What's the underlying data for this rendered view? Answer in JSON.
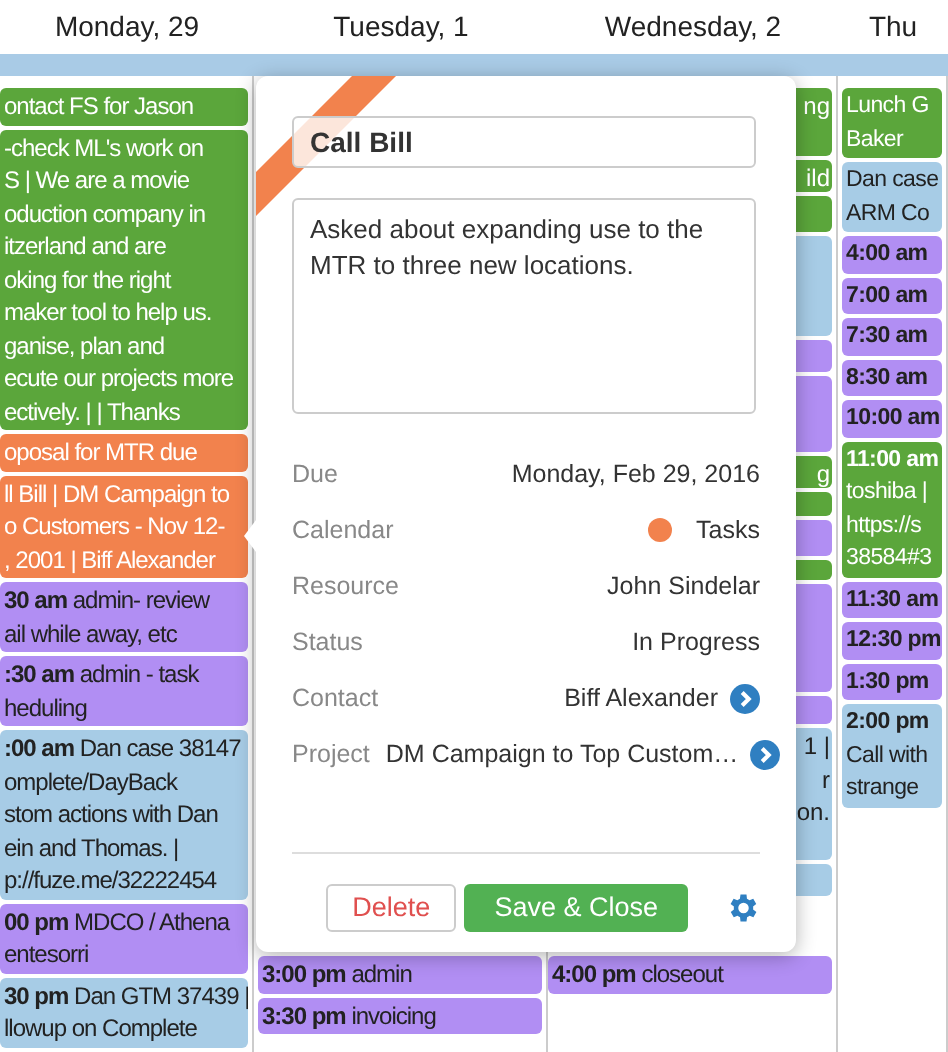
{
  "days": [
    {
      "label": "Monday, 29"
    },
    {
      "label": "Tuesday, 1"
    },
    {
      "label": "Wednesday, 2"
    },
    {
      "label": "Thu"
    }
  ],
  "columns": [
    {
      "events": [
        {
          "color": "#5ba63b",
          "lines": [
            "ontact FS for Jason"
          ]
        },
        {
          "color": "#5ba63b",
          "lines": [
            "-check ML's work on",
            "S | We are a movie",
            "oduction company in",
            "itzerland and are",
            "oking for the right",
            "maker tool to help us.",
            "ganise, plan and",
            "ecute our projects more",
            "ectively. | | Thanks"
          ]
        },
        {
          "color": "#f2824d",
          "lines": [
            "oposal for MTR due"
          ]
        },
        {
          "color": "#f2824d",
          "lines": [
            "ll Bill | DM Campaign to",
            "o Customers - Nov 12-",
            ", 2001 | Biff Alexander"
          ]
        },
        {
          "color": "#b18ef3",
          "time": "30 am",
          "lines": [
            "admin- review",
            "ail while away, etc"
          ]
        },
        {
          "color": "#b18ef3",
          "time": ":30 am",
          "lines": [
            "admin - task",
            "heduling"
          ]
        },
        {
          "color": "#a7cce6",
          "time": ":00 am",
          "lines": [
            "Dan case 38147",
            "omplete/DayBack",
            "stom actions with Dan",
            "ein and Thomas. |",
            "p://fuze.me/32222454"
          ]
        },
        {
          "color": "#b18ef3",
          "time": "00 pm",
          "lines": [
            "MDCO / Athena",
            "entesorri"
          ]
        },
        {
          "color": "#a7cce6",
          "time": "30 pm",
          "lines": [
            "Dan GTM 37439 |",
            "llowup on Complete"
          ]
        }
      ]
    },
    {
      "events": [
        {
          "color": "#b18ef3",
          "time": "3:00 pm",
          "lines": [
            "admin"
          ]
        },
        {
          "color": "#b18ef3",
          "time": "3:30 pm",
          "lines": [
            "invoicing"
          ]
        }
      ]
    },
    {
      "events": [
        {
          "color": "#5ba63b",
          "lines": [
            "ng"
          ]
        },
        {
          "color": "#5ba63b",
          "lines": [
            "ild"
          ]
        },
        {
          "color": "#5ba63b"
        },
        {
          "color": "#a7cce6"
        },
        {
          "color": "#b18ef3"
        },
        {
          "color": "#b18ef3"
        },
        {
          "color": "#5ba63b",
          "lines": [
            "g"
          ]
        },
        {
          "color": "#5ba63b"
        },
        {
          "color": "#b18ef3"
        },
        {
          "color": "#5ba63b"
        },
        {
          "color": "#b18ef3"
        },
        {
          "color": "#b18ef3"
        },
        {
          "color": "#a7cce6",
          "lines": [
            "1 |",
            "r",
            "on."
          ]
        },
        {
          "color": "#a7cce6"
        },
        {
          "color": "#b18ef3",
          "time": "4:00 pm",
          "lines": [
            "closeout"
          ]
        }
      ]
    },
    {
      "events": [
        {
          "color": "#5ba63b",
          "lines": [
            "Lunch G",
            "Baker"
          ]
        },
        {
          "color": "#a7cce6",
          "lines": [
            "Dan case",
            "ARM Co"
          ]
        },
        {
          "color": "#b18ef3",
          "time": "4:00 am"
        },
        {
          "color": "#b18ef3",
          "time": "7:00 am"
        },
        {
          "color": "#b18ef3",
          "time": "7:30 am"
        },
        {
          "color": "#b18ef3",
          "time": "8:30 am"
        },
        {
          "color": "#b18ef3",
          "time": "10:00 am"
        },
        {
          "color": "#5ba63b",
          "time": "11:00 am",
          "lines": [
            "toshiba |",
            "https://s",
            "38584#3"
          ]
        },
        {
          "color": "#b18ef3",
          "time": "11:30 am"
        },
        {
          "color": "#b18ef3",
          "time": "12:30 pm"
        },
        {
          "color": "#b18ef3",
          "time": "1:30 pm"
        },
        {
          "color": "#a7cce6",
          "time": "2:00 pm",
          "lines": [
            "Call with",
            "strange"
          ]
        }
      ]
    }
  ],
  "popover": {
    "title_field": {
      "value": "Call Bill"
    },
    "notes_field": {
      "value": "Asked about expanding use to the MTR to three new locations."
    },
    "fields": [
      {
        "kind": "text",
        "label": "Due",
        "value": "Monday, Feb 29, 2016"
      },
      {
        "kind": "calendar",
        "label": "Calendar",
        "value": "Tasks",
        "color": "#f2824d"
      },
      {
        "kind": "text",
        "label": "Resource",
        "value": "John Sindelar"
      },
      {
        "kind": "text",
        "label": "Status",
        "value": "In Progress"
      },
      {
        "kind": "link",
        "label": "Contact",
        "value": "Biff Alexander"
      },
      {
        "kind": "link",
        "label": "Project",
        "value": "DM Campaign to Top Custom…"
      }
    ],
    "buttons": [
      {
        "kind": "danger",
        "label": "Delete"
      },
      {
        "kind": "primary",
        "label": "Save & Close"
      }
    ]
  }
}
